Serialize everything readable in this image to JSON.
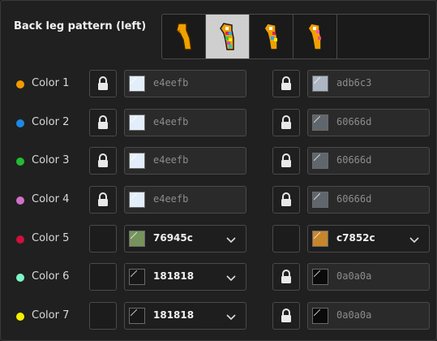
{
  "header": {
    "title": "Back leg pattern (left)"
  },
  "patterns": [
    {
      "name": "pattern-option-solid",
      "selected": false
    },
    {
      "name": "pattern-option-rainbow",
      "selected": true
    },
    {
      "name": "pattern-option-striped-top",
      "selected": false
    },
    {
      "name": "pattern-option-striped-bottom",
      "selected": false
    }
  ],
  "rows": [
    {
      "label": "Color 1",
      "dot": "#f59a00",
      "left": {
        "locked": true,
        "hex": "e4eefb",
        "color": "#e4eefb",
        "dropdown": false
      },
      "right": {
        "locked": true,
        "hex": "adb6c3",
        "color": "#adb6c3",
        "dropdown": false
      }
    },
    {
      "label": "Color 2",
      "dot": "#1e88e5",
      "left": {
        "locked": true,
        "hex": "e4eefb",
        "color": "#e4eefb",
        "dropdown": false
      },
      "right": {
        "locked": true,
        "hex": "60666d",
        "color": "#60666d",
        "dropdown": false
      }
    },
    {
      "label": "Color 3",
      "dot": "#22bb33",
      "left": {
        "locked": true,
        "hex": "e4eefb",
        "color": "#e4eefb",
        "dropdown": false
      },
      "right": {
        "locked": true,
        "hex": "60666d",
        "color": "#60666d",
        "dropdown": false
      }
    },
    {
      "label": "Color 4",
      "dot": "#d070c8",
      "left": {
        "locked": true,
        "hex": "e4eefb",
        "color": "#e4eefb",
        "dropdown": false
      },
      "right": {
        "locked": true,
        "hex": "60666d",
        "color": "#60666d",
        "dropdown": false
      }
    },
    {
      "label": "Color 5",
      "dot": "#d0103a",
      "left": {
        "locked": false,
        "hex": "76945c",
        "color": "#76945c",
        "dropdown": true
      },
      "right": {
        "locked": false,
        "hex": "c7852c",
        "color": "#c7852c",
        "dropdown": true
      }
    },
    {
      "label": "Color 6",
      "dot": "#7ef5c8",
      "left": {
        "locked": false,
        "hex": "181818",
        "color": "#181818",
        "dropdown": true
      },
      "right": {
        "locked": true,
        "hex": "0a0a0a",
        "color": "#0a0a0a",
        "dropdown": false
      }
    },
    {
      "label": "Color 7",
      "dot": "#f5f000",
      "left": {
        "locked": false,
        "hex": "181818",
        "color": "#181818",
        "dropdown": true
      },
      "right": {
        "locked": true,
        "hex": "0a0a0a",
        "color": "#0a0a0a",
        "dropdown": false
      }
    }
  ]
}
